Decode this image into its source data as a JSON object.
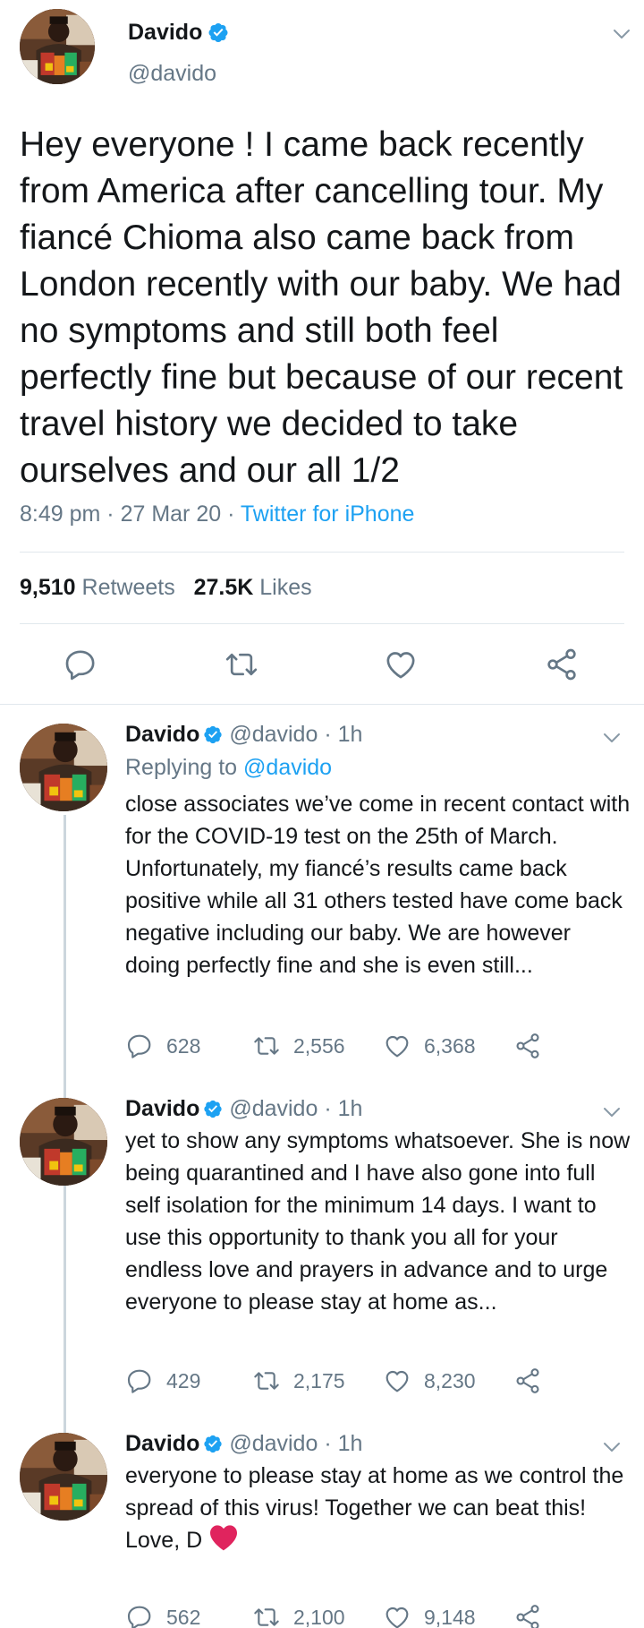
{
  "main_tweet": {
    "name": "Davido",
    "handle": "@davido",
    "text": "Hey everyone ! I came back recently from America after cancelling tour. My fiancé Chioma also came back from London recently with our baby. We had no symptoms and still both feel perfectly fine but because of our recent travel history we decided to take ourselves and our all 1/2",
    "time": "8:49 pm",
    "date": "27 Mar 20",
    "source": "Twitter for iPhone",
    "retweets_count": "9,510",
    "retweets_label": "Retweets",
    "likes_count": "27.5K",
    "likes_label": "Likes",
    "action_icons": [
      "reply-icon",
      "retweet-icon",
      "like-icon",
      "share-icon"
    ]
  },
  "replies": [
    {
      "name": "Davido",
      "handle": "@davido",
      "age": "1h",
      "replying_label": "Replying to",
      "replying_to": "@davido",
      "text": "close associates we’ve come in recent contact with for the COVID-19 test on the 25th of March. Unfortunately, my fiancé’s results came back positive while all 31 others tested have come back negative including our baby. We are however doing perfectly fine and she is even still...",
      "replies": "628",
      "retweets": "2,556",
      "likes": "6,368"
    },
    {
      "name": "Davido",
      "handle": "@davido",
      "age": "1h",
      "text": "yet to show any symptoms whatsoever. She is now being quarantined and I have also gone into full self isolation for the minimum 14 days. I want to use this opportunity to thank you all for your endless love and prayers in advance and to urge everyone to please stay at home as...",
      "replies": "429",
      "retweets": "2,175",
      "likes": "8,230"
    },
    {
      "name": "Davido",
      "handle": "@davido",
      "age": "1h",
      "text": "everyone to please stay at home as we control the spread of this virus! Together we can beat this!",
      "signoff": "Love, D",
      "signoff_emoji": "red-heart-emoji",
      "replies": "562",
      "retweets": "2,100",
      "likes": "9,148"
    }
  ],
  "colors": {
    "text": "#14171a",
    "secondary": "#657786",
    "link": "#1da1f2",
    "verified": "#1da1f2",
    "divider": "#e1e8ed",
    "thread_line": "#ccd6dd",
    "heart": "#e0245e"
  }
}
